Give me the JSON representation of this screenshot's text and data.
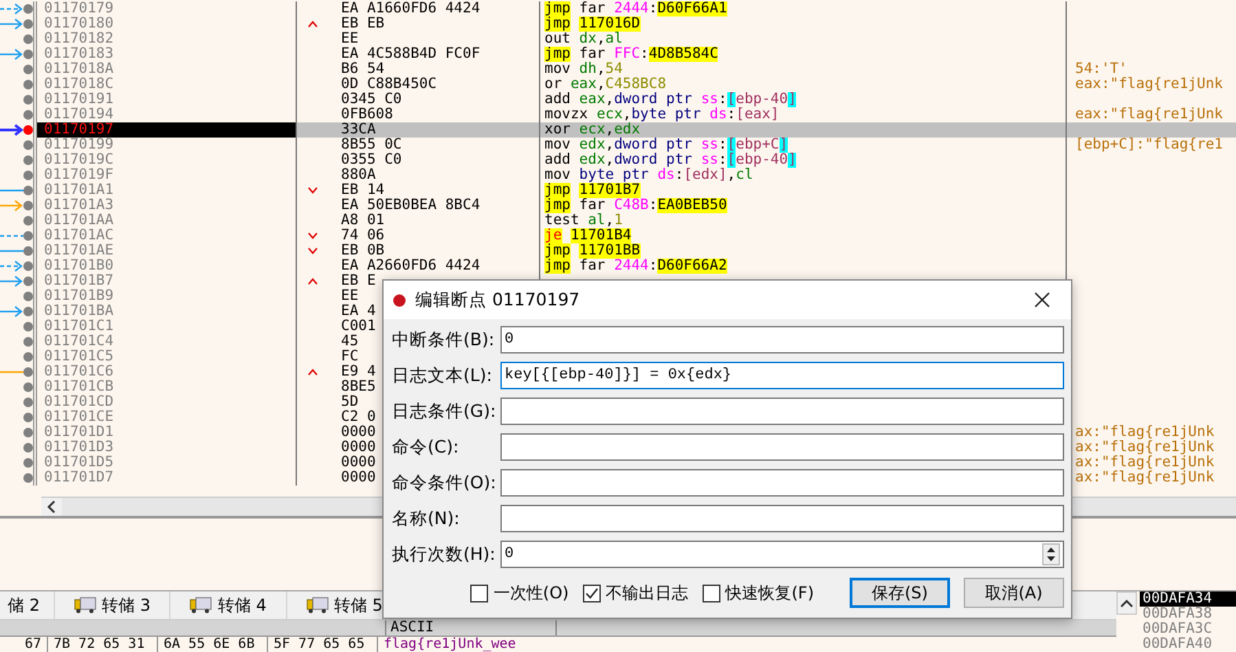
{
  "disassembly": {
    "rows": [
      {
        "address": "01170179",
        "bytes": "EA A1660FD6 4424",
        "arrow": {
          "kind": "dashed",
          "head": true,
          "color": "#1ea0f0"
        },
        "breakpoint": false,
        "selected": false,
        "instruction": [
          {
            "text": "jmp",
            "kind": "jmp"
          },
          {
            "text": " far ",
            "kind": "p"
          },
          {
            "text": "2444",
            "kind": "seg"
          },
          {
            "text": ":",
            "kind": "p"
          },
          {
            "text": "D60F66A1",
            "kind": "addr"
          }
        ]
      },
      {
        "address": "01170180",
        "bytes": "EB EB",
        "branch": {
          "kind": "up"
        },
        "arrow": {
          "kind": "solid",
          "head": true,
          "color": "#1ea0f0"
        },
        "breakpoint": false,
        "selected": false,
        "instruction": [
          {
            "text": "jmp",
            "kind": "jmp"
          },
          {
            "text": "117016D",
            "kind": "addr"
          }
        ]
      },
      {
        "address": "01170182",
        "bytes": "EE",
        "breakpoint": false,
        "selected": false,
        "instruction": [
          {
            "text": "out ",
            "kind": "mn"
          },
          {
            "text": "dx",
            "kind": "reg"
          },
          {
            "text": ",",
            "kind": "p"
          },
          {
            "text": "al",
            "kind": "reg"
          }
        ]
      },
      {
        "address": "01170183",
        "bytes": "EA 4C588B4D FC0F",
        "arrow": {
          "kind": "solid",
          "head": true,
          "color": "#1ea0f0"
        },
        "breakpoint": false,
        "selected": false,
        "instruction": [
          {
            "text": "jmp",
            "kind": "jmp"
          },
          {
            "text": " far ",
            "kind": "p"
          },
          {
            "text": "FFC",
            "kind": "seg"
          },
          {
            "text": ":",
            "kind": "p"
          },
          {
            "text": "4D8B584C",
            "kind": "addr"
          }
        ]
      },
      {
        "address": "0117018A",
        "bytes": "B6 54",
        "breakpoint": false,
        "selected": false,
        "instruction": [
          {
            "text": "mov ",
            "kind": "mn"
          },
          {
            "text": "dh",
            "kind": "reg"
          },
          {
            "text": ",",
            "kind": "p"
          },
          {
            "text": "54",
            "kind": "num"
          }
        ],
        "comment": "54:'T'"
      },
      {
        "address": "0117018C",
        "bytes": "0D C88B450C",
        "breakpoint": false,
        "selected": false,
        "instruction": [
          {
            "text": "or ",
            "kind": "mn"
          },
          {
            "text": "eax",
            "kind": "reg"
          },
          {
            "text": ",",
            "kind": "p"
          },
          {
            "text": "C458BC8",
            "kind": "num"
          }
        ],
        "comment": "eax:\"flag{re1jUnk"
      },
      {
        "address": "01170191",
        "bytes": "0345 C0",
        "breakpoint": false,
        "selected": false,
        "instruction": [
          {
            "text": "add ",
            "kind": "mn"
          },
          {
            "text": "eax",
            "kind": "reg"
          },
          {
            "text": ",",
            "kind": "p"
          },
          {
            "text": "dword ptr ",
            "kind": "size"
          },
          {
            "text": "ss",
            "kind": "seg"
          },
          {
            "text": ":",
            "kind": "p"
          },
          {
            "text": "[",
            "kind": "brk"
          },
          {
            "text": "ebp-40",
            "kind": "mem"
          },
          {
            "text": "]",
            "kind": "brk"
          }
        ]
      },
      {
        "address": "01170194",
        "bytes": "0FB608",
        "breakpoint": false,
        "selected": false,
        "instruction": [
          {
            "text": "movzx ",
            "kind": "mn"
          },
          {
            "text": "ecx",
            "kind": "reg"
          },
          {
            "text": ",",
            "kind": "p"
          },
          {
            "text": "byte ptr ",
            "kind": "size"
          },
          {
            "text": "ds",
            "kind": "seg"
          },
          {
            "text": ":",
            "kind": "p"
          },
          {
            "text": "[eax]",
            "kind": "mem"
          }
        ],
        "comment": "eax:\"flag{re1jUnk"
      },
      {
        "address": "01170197",
        "bytes": "33CA",
        "arrow": {
          "kind": "solid",
          "head": true,
          "color": "#3333ff"
        },
        "breakpoint": true,
        "selected": true,
        "instruction": [
          {
            "text": "xor ",
            "kind": "mn"
          },
          {
            "text": "ecx",
            "kind": "reg"
          },
          {
            "text": ",",
            "kind": "p"
          },
          {
            "text": "edx",
            "kind": "reg"
          }
        ]
      },
      {
        "address": "01170199",
        "bytes": "8B55 0C",
        "breakpoint": false,
        "selected": false,
        "instruction": [
          {
            "text": "mov ",
            "kind": "mn"
          },
          {
            "text": "edx",
            "kind": "reg"
          },
          {
            "text": ",",
            "kind": "p"
          },
          {
            "text": "dword ptr ",
            "kind": "size"
          },
          {
            "text": "ss",
            "kind": "seg"
          },
          {
            "text": ":",
            "kind": "p"
          },
          {
            "text": "[",
            "kind": "brk"
          },
          {
            "text": "ebp+C",
            "kind": "mem"
          },
          {
            "text": "]",
            "kind": "brk"
          }
        ],
        "comment": "[ebp+C]:\"flag{re1"
      },
      {
        "address": "0117019C",
        "bytes": "0355 C0",
        "breakpoint": false,
        "selected": false,
        "instruction": [
          {
            "text": "add ",
            "kind": "mn"
          },
          {
            "text": "edx",
            "kind": "reg"
          },
          {
            "text": ",",
            "kind": "p"
          },
          {
            "text": "dword ptr ",
            "kind": "size"
          },
          {
            "text": "ss",
            "kind": "seg"
          },
          {
            "text": ":",
            "kind": "p"
          },
          {
            "text": "[",
            "kind": "brk"
          },
          {
            "text": "ebp-40",
            "kind": "mem"
          },
          {
            "text": "]",
            "kind": "brk"
          }
        ]
      },
      {
        "address": "0117019F",
        "bytes": "880A",
        "breakpoint": false,
        "selected": false,
        "instruction": [
          {
            "text": "mov ",
            "kind": "mn"
          },
          {
            "text": "byte ptr ",
            "kind": "size"
          },
          {
            "text": "ds",
            "kind": "seg"
          },
          {
            "text": ":",
            "kind": "p"
          },
          {
            "text": "[edx]",
            "kind": "mem"
          },
          {
            "text": ",",
            "kind": "p"
          },
          {
            "text": "cl",
            "kind": "reg"
          }
        ]
      },
      {
        "address": "011701A1",
        "bytes": "EB 14",
        "branch": {
          "kind": "down"
        },
        "arrow": {
          "kind": "solid",
          "head": false,
          "color": "#1ea0f0"
        },
        "breakpoint": false,
        "selected": false,
        "instruction": [
          {
            "text": "jmp",
            "kind": "jmp"
          },
          {
            "text": "11701B7",
            "kind": "addr"
          }
        ]
      },
      {
        "address": "011701A3",
        "bytes": "EA 50EB0BEA 8BC4",
        "arrow": {
          "kind": "solid",
          "head": true,
          "color": "#ffa500"
        },
        "breakpoint": false,
        "selected": false,
        "instruction": [
          {
            "text": "jmp",
            "kind": "jmp"
          },
          {
            "text": " far ",
            "kind": "p"
          },
          {
            "text": "C48B",
            "kind": "seg"
          },
          {
            "text": ":",
            "kind": "p"
          },
          {
            "text": "EA0BEB50",
            "kind": "addr"
          }
        ]
      },
      {
        "address": "011701AA",
        "bytes": "A8 01",
        "breakpoint": false,
        "selected": false,
        "instruction": [
          {
            "text": "test ",
            "kind": "mn"
          },
          {
            "text": "al",
            "kind": "reg"
          },
          {
            "text": ",",
            "kind": "p"
          },
          {
            "text": "1",
            "kind": "num"
          }
        ]
      },
      {
        "address": "011701AC",
        "bytes": "74 06",
        "branch": {
          "kind": "down"
        },
        "arrow": {
          "kind": "dashed",
          "head": false,
          "color": "#1ea0f0"
        },
        "breakpoint": false,
        "selected": false,
        "instruction": [
          {
            "text": "je",
            "kind": "jcc"
          },
          {
            "text": "11701B4",
            "kind": "addr"
          }
        ]
      },
      {
        "address": "011701AE",
        "bytes": "EB 0B",
        "branch": {
          "kind": "down"
        },
        "arrow": {
          "kind": "solid",
          "head": false,
          "color": "#1ea0f0"
        },
        "breakpoint": false,
        "selected": false,
        "instruction": [
          {
            "text": "jmp",
            "kind": "jmp"
          },
          {
            "text": "11701BB",
            "kind": "addr"
          }
        ]
      },
      {
        "address": "011701B0",
        "bytes": "EA A2660FD6 4424",
        "arrow": {
          "kind": "dashed",
          "head": true,
          "color": "#1ea0f0"
        },
        "breakpoint": false,
        "selected": false,
        "instruction": [
          {
            "text": "jmp",
            "kind": "jmp"
          },
          {
            "text": " far ",
            "kind": "p"
          },
          {
            "text": "2444",
            "kind": "seg"
          },
          {
            "text": ":",
            "kind": "p"
          },
          {
            "text": "D60F66A2",
            "kind": "addr"
          }
        ]
      },
      {
        "address": "011701B7",
        "bytes": "EB E",
        "branch": {
          "kind": "up"
        },
        "arrow": {
          "kind": "solid",
          "head": true,
          "color": "#1ea0f0"
        },
        "breakpoint": false,
        "selected": false
      },
      {
        "address": "011701B9",
        "bytes": "EE",
        "breakpoint": false,
        "selected": false
      },
      {
        "address": "011701BA",
        "bytes": "EA 4",
        "arrow": {
          "kind": "solid",
          "head": true,
          "color": "#1ea0f0"
        },
        "breakpoint": false,
        "selected": false
      },
      {
        "address": "011701C1",
        "bytes": "C001",
        "breakpoint": false,
        "selected": false
      },
      {
        "address": "011701C4",
        "bytes": "45",
        "breakpoint": false,
        "selected": false
      },
      {
        "address": "011701C5",
        "bytes": "FC",
        "breakpoint": false,
        "selected": false
      },
      {
        "address": "011701C6",
        "bytes": "E9 4",
        "branch": {
          "kind": "up"
        },
        "arrow": {
          "kind": "solid",
          "head": false,
          "color": "#ffa500"
        },
        "breakpoint": false,
        "selected": false
      },
      {
        "address": "011701CB",
        "bytes": "8BE5",
        "breakpoint": false,
        "selected": false
      },
      {
        "address": "011701CD",
        "bytes": "5D",
        "breakpoint": false,
        "selected": false
      },
      {
        "address": "011701CE",
        "bytes": "C2 0",
        "breakpoint": false,
        "selected": false
      },
      {
        "address": "011701D1",
        "bytes": "0000",
        "breakpoint": false,
        "selected": false,
        "comment": "ax:\"flag{re1jUnk"
      },
      {
        "address": "011701D3",
        "bytes": "0000",
        "breakpoint": false,
        "selected": false,
        "comment": "ax:\"flag{re1jUnk"
      },
      {
        "address": "011701D5",
        "bytes": "0000",
        "breakpoint": false,
        "selected": false,
        "comment": "ax:\"flag{re1jUnk"
      },
      {
        "address": "011701D7",
        "bytes": "0000",
        "breakpoint": false,
        "selected": false,
        "comment": "ax:\"flag{re1jUnk"
      }
    ]
  },
  "dump_tabs": [
    {
      "label": "储 2",
      "icon": false
    },
    {
      "label": "转储 3",
      "icon": true
    },
    {
      "label": "转储 4",
      "icon": true
    },
    {
      "label": "转储 5",
      "icon": true
    }
  ],
  "dump": {
    "ascii_header": "ASCII",
    "hex": [
      "67",
      "7B 72 65 31",
      "6A 55 6E 6B",
      "5F 77 65 65"
    ],
    "ascii": "flag{re1jUnk_wee"
  },
  "stack": [
    {
      "address": "00DAFA34",
      "selected": true
    },
    {
      "address": "00DAFA38",
      "selected": false
    },
    {
      "address": "00DAFA3C",
      "selected": false
    },
    {
      "address": "00DAFA40",
      "selected": false
    }
  ],
  "dialog": {
    "title": "编辑断点 01170197",
    "fields": [
      {
        "label": "中断条件(B):",
        "value": "0",
        "kind": "text",
        "focused": false
      },
      {
        "label": "日志文本(L):",
        "value": "key[{[ebp-40]}] = 0x{edx}",
        "kind": "text",
        "focused": true
      },
      {
        "label": "日志条件(G):",
        "kind": "text",
        "focused": false
      },
      {
        "label": "命令(C):",
        "kind": "text",
        "focused": false
      },
      {
        "label": "命令条件(O):",
        "kind": "text",
        "focused": false
      },
      {
        "label": "名称(N):",
        "kind": "text",
        "focused": false
      },
      {
        "label": "执行次数(H):",
        "value": "0",
        "kind": "spin",
        "focused": false
      }
    ],
    "checkboxes": [
      {
        "label": "一次性(O)",
        "checked": false
      },
      {
        "label": "不输出日志",
        "checked": true
      },
      {
        "label": "快速恢复(F)",
        "checked": false
      }
    ],
    "buttons": [
      {
        "label": "保存(S)",
        "default": true
      },
      {
        "label": "取消(A)",
        "default": false
      }
    ]
  }
}
